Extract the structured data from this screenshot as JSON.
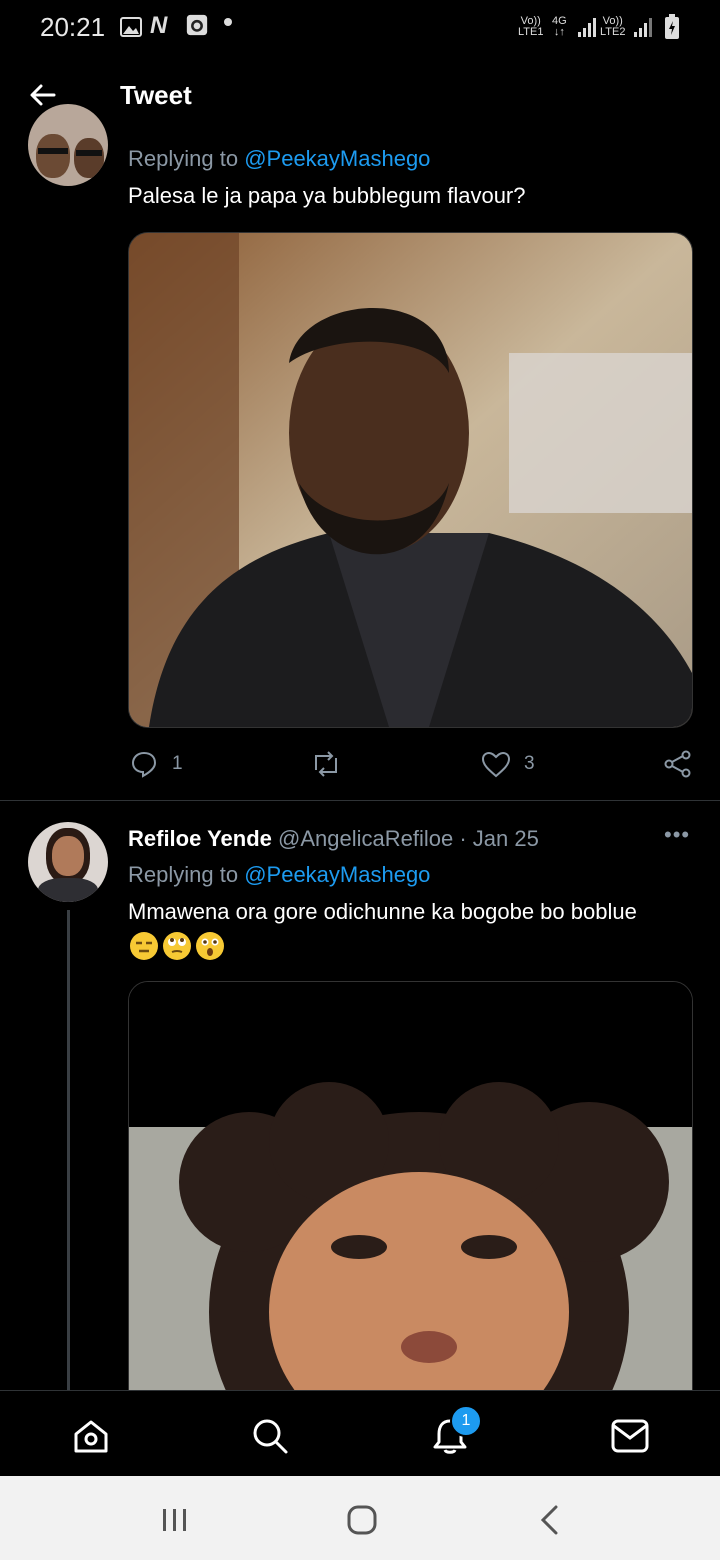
{
  "status_bar": {
    "time": "20:21",
    "sim1_voip": "Vo))",
    "sim1_lte": "LTE1",
    "network": "4G",
    "sim2_voip": "Vo))",
    "sim2_lte": "LTE2",
    "icons": [
      "gallery-icon",
      "n-icon",
      "alarm-icon",
      "dot-icon",
      "signal-icon",
      "battery-icon"
    ]
  },
  "header": {
    "title": "Tweet"
  },
  "tweet1": {
    "replying_prefix": "Replying to",
    "replying_handle": "@PeekayMashego",
    "text": "Palesa le ja papa ya bubblegum flavour?",
    "reply_count": "1",
    "like_count": "3"
  },
  "tweet2": {
    "name": "Refiloe Yende",
    "handle": "@AngelicaRefiloe",
    "separator": "·",
    "date": "Jan 25",
    "replying_prefix": "Replying to",
    "replying_handle": "@PeekayMashego",
    "text": "Mmawena ora gore odichunne ka bogobe bo boblue",
    "emojis": [
      "expressionless-face-emoji",
      "eye-roll-emoji",
      "astonished-face-emoji"
    ]
  },
  "bottom_nav": {
    "items": [
      "home",
      "search",
      "notifications",
      "messages"
    ],
    "notification_badge": "1"
  },
  "colors": {
    "accent": "#1d9bf0",
    "muted": "#8b98a5",
    "background": "#000000"
  }
}
